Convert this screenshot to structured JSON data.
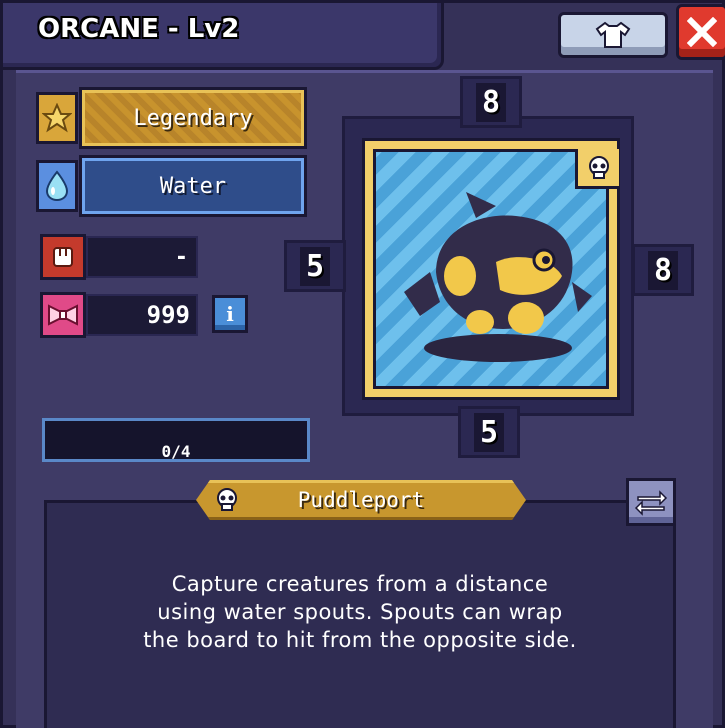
{
  "title": "ORCANE - Lv2",
  "rarity": {
    "label": "Legendary",
    "icon": "star-badge-icon"
  },
  "element": {
    "label": "Water",
    "icon": "water-drop-icon"
  },
  "stats": {
    "power": {
      "value": "-",
      "icon": "fist-icon"
    },
    "capture": {
      "value": "999",
      "icon": "bow-icon"
    }
  },
  "xp": {
    "text": "0/4",
    "current": 0,
    "max": 4
  },
  "card": {
    "top": "8",
    "left": "5",
    "right": "8",
    "bottom": "5",
    "creature": "orca-creature-sprite"
  },
  "ability": {
    "name": "Puddleport",
    "description_lines": [
      "Capture creatures from a distance",
      "using water spouts. Spouts can wrap",
      "the board to hit from the opposite side."
    ]
  },
  "colors": {
    "window": "#353158",
    "legendary": "#c8932d",
    "water": "#2f4d8a",
    "card_border": "#f2cf6a",
    "close": "#e03a2e"
  }
}
